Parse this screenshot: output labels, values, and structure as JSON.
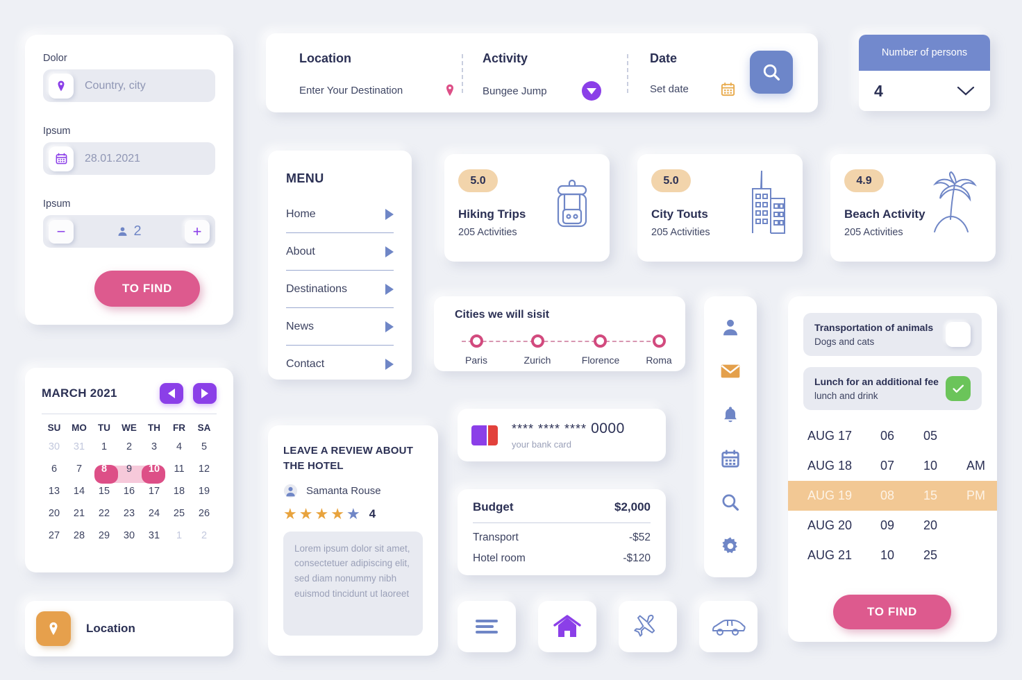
{
  "left_panel": {
    "label1": "Dolor",
    "location_value": "Country, city",
    "label2": "Ipsum",
    "date_value": "28.01.2021",
    "label3": "Ipsum",
    "persons_count": "2",
    "minus": "−",
    "plus": "+",
    "find_button": "TO FIND"
  },
  "searchbar": {
    "location_title": "Location",
    "location_value": "Enter Your Destination",
    "activity_title": "Activity",
    "activity_value": "Bungee Jump",
    "date_title": "Date",
    "date_value": "Set date"
  },
  "persons_dropdown": {
    "header": "Number of persons",
    "value": "4"
  },
  "menu": {
    "title": "MENU",
    "items": [
      {
        "label": "Home"
      },
      {
        "label": "About"
      },
      {
        "label": "Destinations"
      },
      {
        "label": "News"
      },
      {
        "label": "Contact"
      }
    ]
  },
  "activity_cards": [
    {
      "rating": "5.0",
      "name": "Hiking Trips",
      "sub": "205 Activities",
      "icon": "backpack-icon"
    },
    {
      "rating": "5.0",
      "name": "City Touts",
      "sub": "205 Activities",
      "icon": "buildings-icon"
    },
    {
      "rating": "4.9",
      "name": "Beach Activity",
      "sub": "205 Activities",
      "icon": "palm-tree-icon"
    }
  ],
  "cities": {
    "title": "Cities we will sisit",
    "stops": [
      "Paris",
      "Zurich",
      "Florence",
      "Roma"
    ]
  },
  "calendar": {
    "month": "MARCH 2021",
    "dow": [
      "SU",
      "MO",
      "TU",
      "WE",
      "TH",
      "FR",
      "SA"
    ],
    "weeks": [
      [
        {
          "d": "30",
          "out": true
        },
        {
          "d": "31",
          "out": true
        },
        {
          "d": "1"
        },
        {
          "d": "2"
        },
        {
          "d": "3"
        },
        {
          "d": "4"
        },
        {
          "d": "5"
        }
      ],
      [
        {
          "d": "6"
        },
        {
          "d": "7"
        },
        {
          "d": "8",
          "sel": true
        },
        {
          "d": "9",
          "range": true
        },
        {
          "d": "10",
          "sel": true
        },
        {
          "d": "11"
        },
        {
          "d": "12"
        }
      ],
      [
        {
          "d": "13"
        },
        {
          "d": "14"
        },
        {
          "d": "15"
        },
        {
          "d": "16"
        },
        {
          "d": "17"
        },
        {
          "d": "18"
        },
        {
          "d": "19"
        }
      ],
      [
        {
          "d": "20"
        },
        {
          "d": "21"
        },
        {
          "d": "22"
        },
        {
          "d": "23"
        },
        {
          "d": "24"
        },
        {
          "d": "25"
        },
        {
          "d": "26"
        }
      ],
      [
        {
          "d": "27"
        },
        {
          "d": "28"
        },
        {
          "d": "29"
        },
        {
          "d": "30"
        },
        {
          "d": "31"
        },
        {
          "d": "1",
          "out": true
        },
        {
          "d": "2",
          "out": true
        }
      ]
    ]
  },
  "location_tile": {
    "label": "Location"
  },
  "review": {
    "title": "LEAVE A REVIEW ABOUT THE HOTEL",
    "user": "Samanta Rouse",
    "rating": "4",
    "stars_filled": 4,
    "stars_total": 5,
    "text": "Lorem ipsum dolor sit amet, consectetuer adipiscing elit, sed diam nonummy nibh euismod tincidunt ut laoreet"
  },
  "bank_card": {
    "masked": "**** **** ****",
    "last4": "0000",
    "sub": "your bank card"
  },
  "budget": {
    "title": "Budget",
    "total": "$2,000",
    "rows": [
      {
        "label": "Transport",
        "value": "-$52"
      },
      {
        "label": "Hotel room",
        "value": "-$120"
      }
    ]
  },
  "icon_strip": [
    {
      "name": "user-icon"
    },
    {
      "name": "mail-icon"
    },
    {
      "name": "bell-icon"
    },
    {
      "name": "calendar-icon"
    },
    {
      "name": "search-icon"
    },
    {
      "name": "gear-icon"
    }
  ],
  "options_panel": {
    "option1_title": "Transportation of animals",
    "option1_sub": "Dogs and cats",
    "option1_checked": false,
    "option2_title": "Lunch for an additional fee",
    "option2_sub": "lunch and drink",
    "option2_checked": true,
    "time_rows": [
      {
        "date": "AUG 17",
        "hour": "06",
        "minute": "05",
        "meridiem": "",
        "selected": false
      },
      {
        "date": "AUG 18",
        "hour": "07",
        "minute": "10",
        "meridiem": "AM",
        "selected": false
      },
      {
        "date": "AUG 19",
        "hour": "08",
        "minute": "15",
        "meridiem": "PM",
        "selected": true
      },
      {
        "date": "AUG 20",
        "hour": "09",
        "minute": "20",
        "meridiem": "",
        "selected": false
      },
      {
        "date": "AUG 21",
        "hour": "10",
        "minute": "25",
        "meridiem": "",
        "selected": false
      }
    ],
    "find_button": "TO FIND"
  },
  "bottom_icons": [
    {
      "name": "menu-lines-icon"
    },
    {
      "name": "home-icon"
    },
    {
      "name": "airplane-icon"
    },
    {
      "name": "car-icon"
    }
  ],
  "colors": {
    "background": "#eef0f5",
    "pink": "#dd5a8e",
    "purple": "#8b3fe8",
    "blue": "#6f86c6",
    "orange": "#e6a04c",
    "green": "#6bc45a",
    "badge_tan": "#f2d4ab",
    "highlight_tan": "#f2c894"
  }
}
